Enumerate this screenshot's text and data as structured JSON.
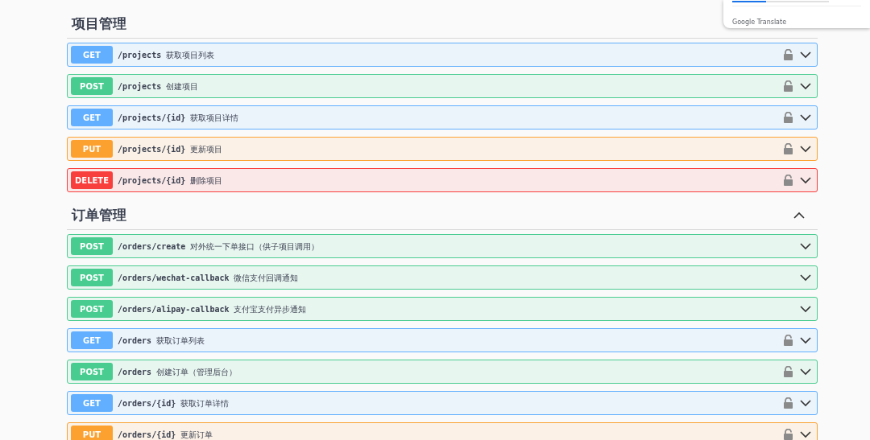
{
  "sections": [
    {
      "title": "项目管理",
      "operations": [
        {
          "method": "GET",
          "path": "/projects",
          "summary": "获取项目列表",
          "secured": true
        },
        {
          "method": "POST",
          "path": "/projects",
          "summary": "创建项目",
          "secured": true
        },
        {
          "method": "GET",
          "path": "/projects/{id}",
          "summary": "获取项目详情",
          "secured": true
        },
        {
          "method": "PUT",
          "path": "/projects/{id}",
          "summary": "更新项目",
          "secured": true
        },
        {
          "method": "DELETE",
          "path": "/projects/{id}",
          "summary": "删除项目",
          "secured": true
        }
      ]
    },
    {
      "title": "订单管理",
      "expanded": true,
      "operations": [
        {
          "method": "POST",
          "path": "/orders/create",
          "summary": "对外统一下单接口（供子项目调用）",
          "secured": false
        },
        {
          "method": "POST",
          "path": "/orders/wechat-callback",
          "summary": "微信支付回调通知",
          "secured": false
        },
        {
          "method": "POST",
          "path": "/orders/alipay-callback",
          "summary": "支付宝支付异步通知",
          "secured": false
        },
        {
          "method": "GET",
          "path": "/orders",
          "summary": "获取订单列表",
          "secured": true
        },
        {
          "method": "POST",
          "path": "/orders",
          "summary": "创建订单（管理后台）",
          "secured": true
        },
        {
          "method": "GET",
          "path": "/orders/{id}",
          "summary": "获取订单详情",
          "secured": true
        },
        {
          "method": "PUT",
          "path": "/orders/{id}",
          "summary": "更新订单",
          "secured": true
        }
      ]
    }
  ],
  "translate_popup": {
    "label": "Google Translate",
    "level": 0.35
  }
}
